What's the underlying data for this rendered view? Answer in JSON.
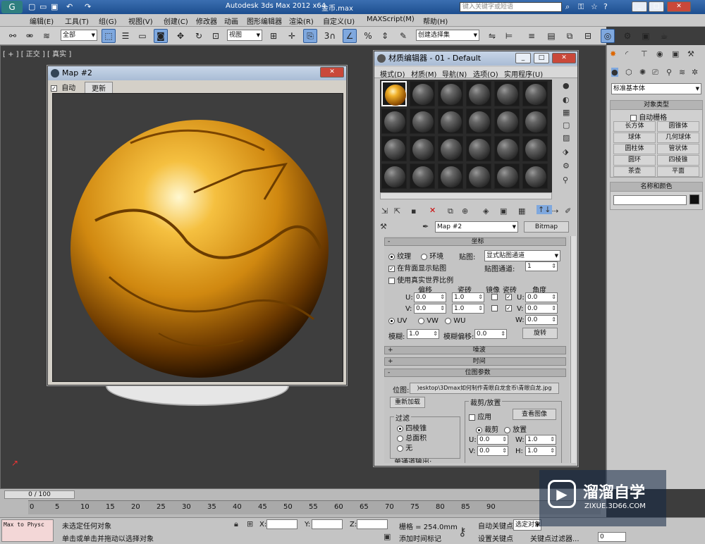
{
  "app": {
    "title": "Autodesk 3ds Max  2012 x64",
    "filename": "金币.max",
    "search_placeholder": "键入关键字或短语"
  },
  "menu": [
    "编辑(E)",
    "工具(T)",
    "组(G)",
    "视图(V)",
    "创建(C)",
    "修改器",
    "动画",
    "图形编辑器",
    "渲染(R)",
    "自定义(U)",
    "MAXScript(M)",
    "帮助(H)"
  ],
  "toolbar": {
    "filter": "全部",
    "view": "视图",
    "selection_set": "创建选择集",
    "snap_num": "3"
  },
  "viewport": {
    "label": "[ + ] [ 正交 ] [ 真实 ]"
  },
  "map_window": {
    "title": "Map #2",
    "auto_label": "自动",
    "update_label": "更新"
  },
  "mat_editor": {
    "title": "材质编辑器 - 01 - Default",
    "menus": [
      "模式(D)",
      "材质(M)",
      "导航(N)",
      "选项(O)",
      "实用程序(U)"
    ],
    "map_name": "Map #2",
    "map_type": "Bitmap",
    "coords": {
      "header": "坐标",
      "texture": "纹理",
      "environ": "环境",
      "mapping_label": "贴图:",
      "mapping": "显式贴图通道",
      "show_back": "在背面显示贴图",
      "map_channel_label": "贴图通道:",
      "map_channel": "1",
      "real_world": "使用真实世界比例",
      "offset": "偏移",
      "tiling": "瓷砖",
      "mirror": "镜像",
      "tile": "瓷砖",
      "angle": "角度",
      "u": "U:",
      "v": "V:",
      "w": "W:",
      "u_offset": "0.0",
      "v_offset": "0.0",
      "u_tiling": "1.0",
      "v_tiling": "1.0",
      "u_angle": "0.0",
      "v_angle": "0.0",
      "w_angle": "0.0",
      "uv": "UV",
      "vw": "VW",
      "wu": "WU",
      "blur_label": "模糊:",
      "blur": "1.0",
      "blur_offset_label": "模糊偏移:",
      "blur_offset": "0.0",
      "rotate": "旋转"
    },
    "noise": "噪波",
    "time": "时间",
    "bitmap_params": "位图参数",
    "bitmap_label": "位图:",
    "bitmap_path": ")esktop\\3Dmax如何制作青眼白龙金币\\青眼白龙.jpg",
    "reload": "重新加载",
    "crop_header": "裁剪/放置",
    "apply": "应用",
    "view_image": "查看图像",
    "crop": "裁剪",
    "place": "放置",
    "crop_u": "0.0",
    "crop_v": "0.0",
    "crop_w": "1.0",
    "crop_h": "1.0",
    "W": "W:",
    "H": "H:",
    "filter_header": "过滤",
    "filter_pyramid": "四棱锥",
    "filter_sat": "总面积",
    "filter_none": "无",
    "mono_output": "单通道输出:"
  },
  "cmd": {
    "category": "标准基本体",
    "object_type": "对象类型",
    "autogrid": "自动栅格",
    "buttons": [
      "长方体",
      "圆锥体",
      "球体",
      "几何球体",
      "圆柱体",
      "管状体",
      "圆环",
      "四棱锥",
      "茶壶",
      "平面"
    ],
    "name_color": "名称和颜色"
  },
  "timeline": {
    "frame": "0 / 100",
    "ticks": [
      "0",
      "5",
      "10",
      "15",
      "20",
      "25",
      "30",
      "35",
      "40",
      "45",
      "50",
      "55",
      "60",
      "65",
      "70",
      "75",
      "80",
      "85",
      "90"
    ]
  },
  "status": {
    "script": "Max to Physc",
    "selected": "未选定任何对象",
    "hint": "单击或单击并拖动以选择对象",
    "x": "X:",
    "y": "Y:",
    "z": "Z:",
    "grid": "栅格 = 254.0mm",
    "add_key": "添加时间标记",
    "auto_key": "自动关键点",
    "set_key": "设置关键点",
    "sel_obj": "选定对象",
    "key_filter": "关键点过滤器...",
    "frame_field": "0"
  },
  "watermark": {
    "brand": "溜溜自学",
    "url": "ZIXUE.3D66.COM"
  }
}
